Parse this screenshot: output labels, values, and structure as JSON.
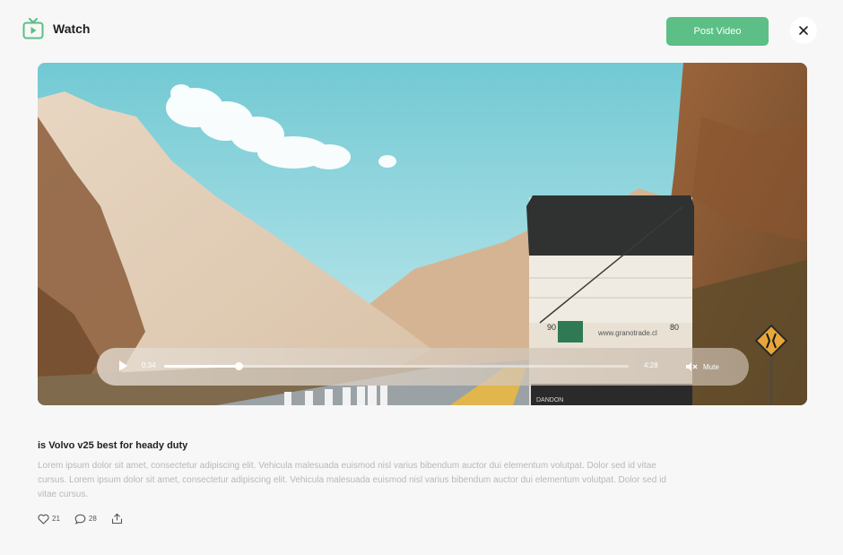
{
  "header": {
    "title": "Watch",
    "brand_icon": "tv-icon",
    "post_button_label": "Post Video",
    "close_icon": "close-icon"
  },
  "colors": {
    "accent": "#5bbf86",
    "background": "#f7f7f7",
    "text": "#1f1f1f",
    "muted_text": "#b8b8b8"
  },
  "player": {
    "current_time": "0:34",
    "total_time": "4:28",
    "progress_fraction": 0.16,
    "mute_label": "Mute",
    "play_icon": "play-icon",
    "mute_icon": "speaker-mute-icon"
  },
  "post": {
    "title": "is Volvo v25 best for heady duty",
    "body": "Lorem ipsum dolor sit amet, consectetur adipiscing elit. Vehicula malesuada euismod nisl varius bibendum auctor dui elementum volutpat. Dolor sed id vitae cursus. Lorem ipsum dolor sit amet, consectetur adipiscing elit. Vehicula malesuada euismod nisl varius bibendum auctor dui elementum volutpat. Dolor sed id vitae cursus."
  },
  "actions": {
    "likes": "21",
    "comments": "28",
    "like_icon": "heart-icon",
    "comment_icon": "comment-icon",
    "share_icon": "share-icon"
  },
  "scene": {
    "truck_plate_text": "90",
    "truck_number": "80",
    "truck_url": "www.granotrade.cl",
    "truck_bottom_text": "DANDON"
  }
}
